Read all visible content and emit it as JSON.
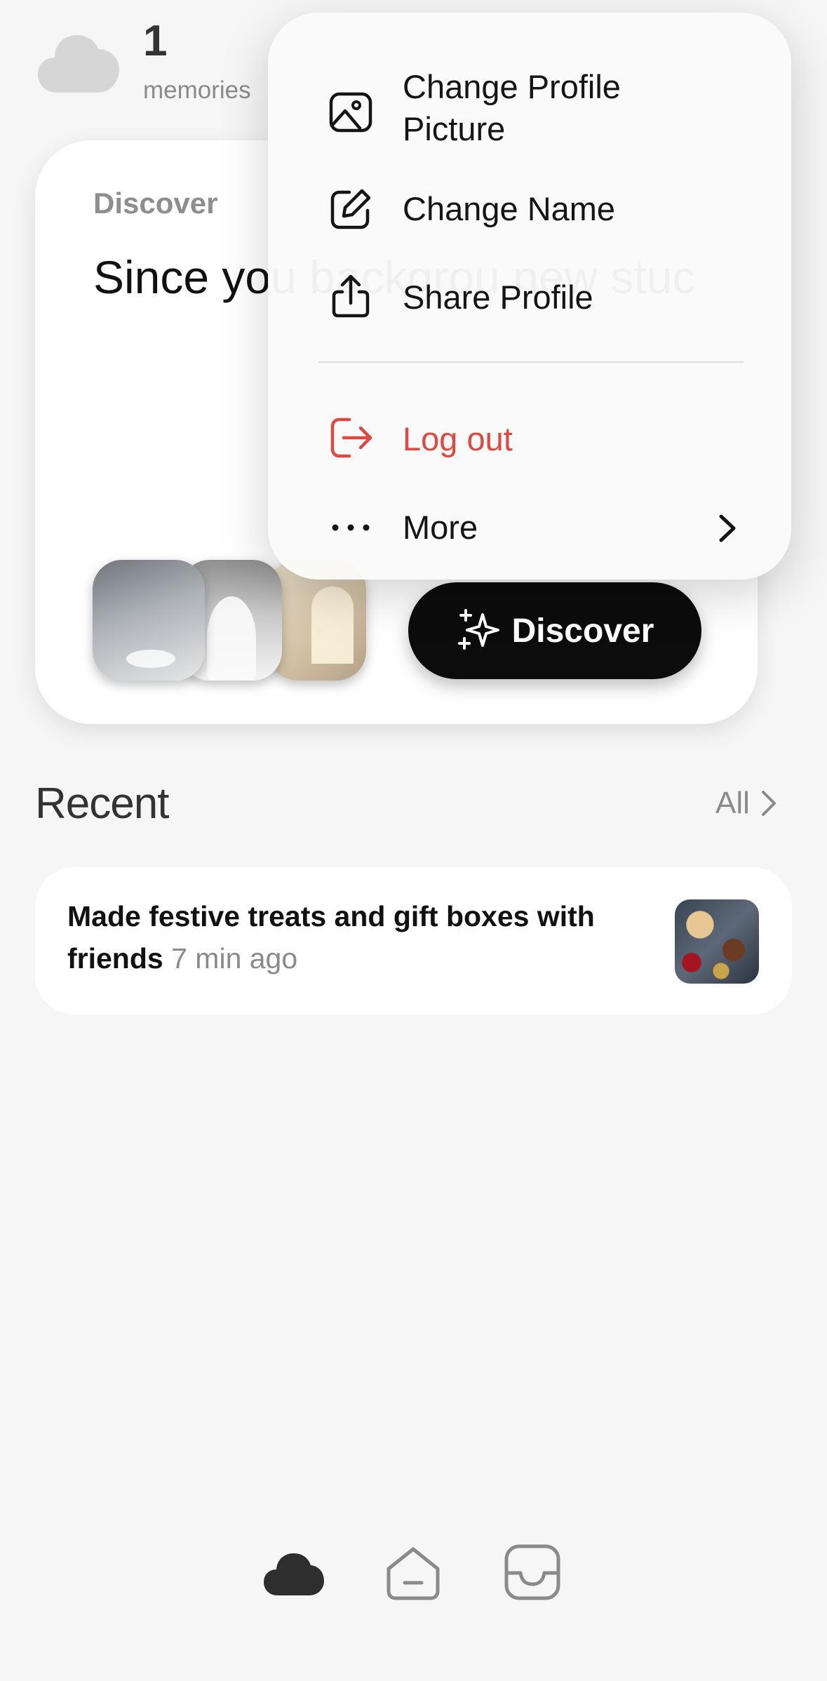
{
  "header": {
    "memories_count": "1",
    "memories_label": "memories"
  },
  "discover_card": {
    "eyebrow": "Discover",
    "headline": "Since you backgrou new stuc",
    "button_label": "Discover"
  },
  "recent": {
    "title": "Recent",
    "all_label": "All",
    "items": [
      {
        "text": "Made festive treats and gift boxes with friends",
        "time": "7 min ago"
      }
    ]
  },
  "menu": {
    "items": [
      {
        "label": "Change Profile Picture",
        "icon": "image-icon"
      },
      {
        "label": "Change Name",
        "icon": "edit-icon"
      },
      {
        "label": "Share Profile",
        "icon": "share-icon"
      },
      {
        "label": "Log out",
        "icon": "logout-icon",
        "color": "#e0493f"
      },
      {
        "label": "More",
        "icon": "more-dots-icon"
      }
    ]
  },
  "tabbar": {
    "tabs": [
      {
        "icon": "cloud-icon",
        "active": true
      },
      {
        "icon": "home-icon",
        "active": false
      },
      {
        "icon": "inbox-icon",
        "active": false
      }
    ]
  },
  "colors": {
    "background": "#f6f6f6",
    "accent_dark": "#0c0c0c",
    "destructive": "#e0493f",
    "muted_text": "#8a8a8a"
  }
}
